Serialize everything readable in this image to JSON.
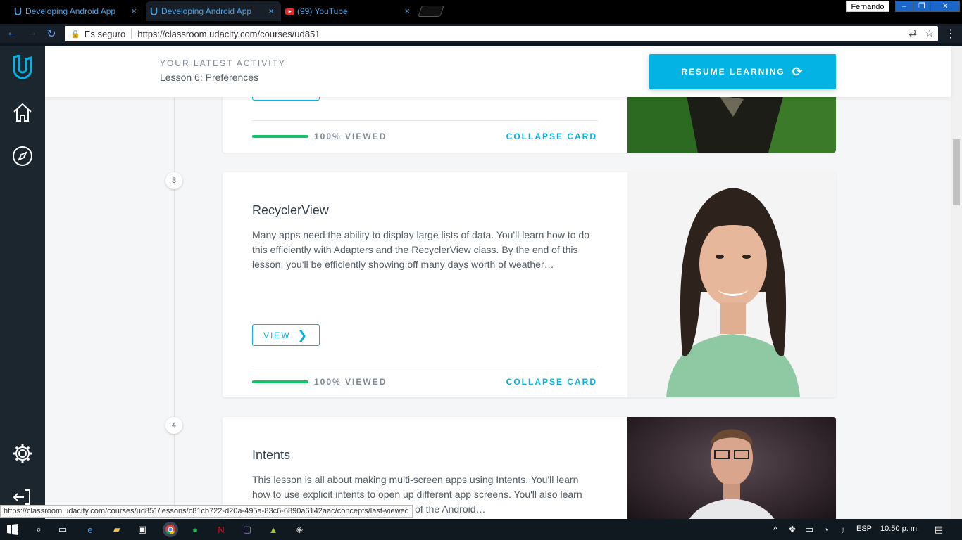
{
  "browser": {
    "tabs": [
      {
        "title": "Developing Android App",
        "close": "×"
      },
      {
        "title": "Developing Android App",
        "close": "×"
      },
      {
        "title": "(99) YouTube",
        "close": "×"
      }
    ],
    "user": "Fernando",
    "window_buttons": [
      "–",
      "❐",
      "X"
    ],
    "secure_label": "Es seguro",
    "url": "https://classroom.udacity.com/courses/ud851",
    "status_url": "https://classroom.udacity.com/courses/ud851/lessons/c81cb722-d20a-495a-83c6-6890a6142aac/concepts/last-viewed"
  },
  "header": {
    "kicker": "YOUR LATEST ACTIVITY",
    "lesson": "Lesson 6: Preferences",
    "resume_label": "RESUME LEARNING"
  },
  "cards": [
    {
      "viewed": "100% VIEWED",
      "collapse": "COLLAPSE CARD"
    },
    {
      "number": "3",
      "title": "RecyclerView",
      "description": "Many apps need the ability to display large lists of data. You'll learn how to do this efficiently with Adapters and the RecyclerView class. By the end of this lesson, you'll be efficiently showing off many days worth of weather…",
      "view_label": "VIEW",
      "viewed": "100% VIEWED",
      "collapse": "COLLAPSE CARD",
      "progress": 1.0
    },
    {
      "number": "4",
      "title": "Intents",
      "description": "This lesson is all about making multi-screen apps using Intents. You'll learn how to use explicit intents to open up different app screens. You'll also learn about implicit intents, a powerful part of the Android…"
    }
  ],
  "taskbar": {
    "lang": "ESP",
    "time": "10:50 p. m."
  },
  "colors": {
    "accent": "#02b3e4",
    "progress": "#15c26b",
    "sidebar": "#1c262f"
  }
}
